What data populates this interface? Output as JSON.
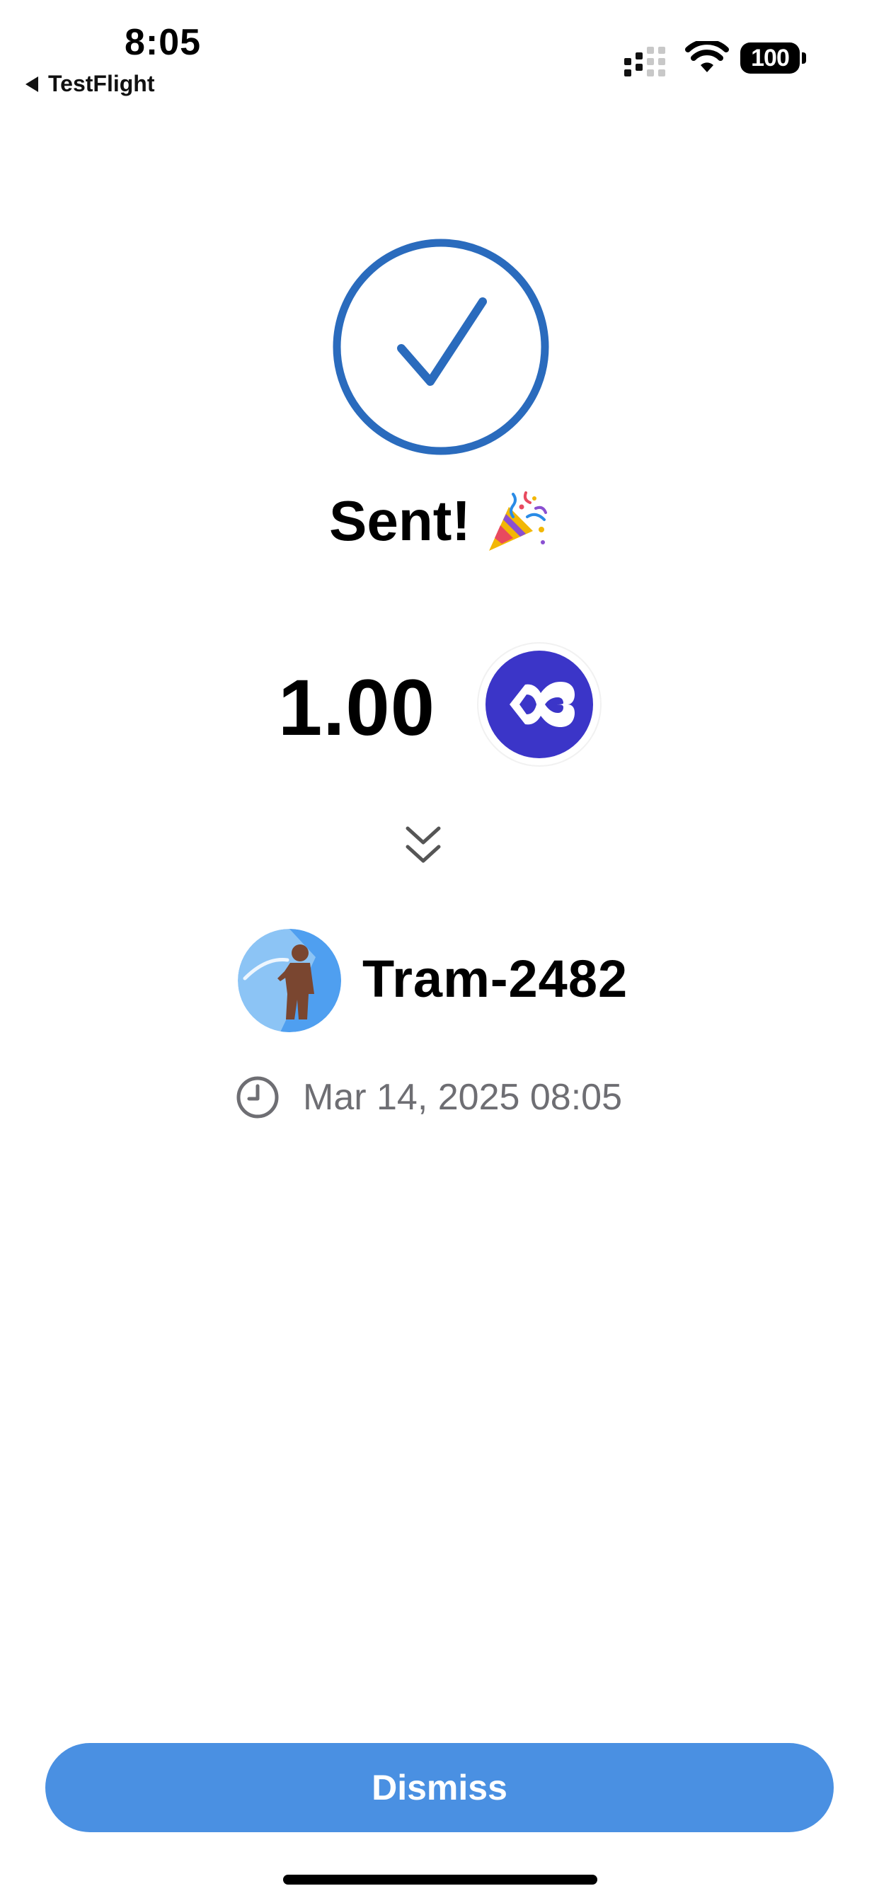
{
  "status_bar": {
    "time": "8:05",
    "back_app": "TestFlight",
    "battery": "100"
  },
  "success": {
    "title": "Sent!",
    "party_icon": "party-popper-icon"
  },
  "transfer": {
    "amount": "1.00",
    "token_icon": "token-logo-icon"
  },
  "recipient": {
    "name": "Tram-2482",
    "timestamp": "Mar 14, 2025 08:05"
  },
  "actions": {
    "dismiss_label": "Dismiss"
  },
  "colors": {
    "accent_blue": "#2a6bbd",
    "button_blue": "#4a90e2",
    "token_purple": "#3b35c8",
    "muted_text": "#6e6e73"
  }
}
